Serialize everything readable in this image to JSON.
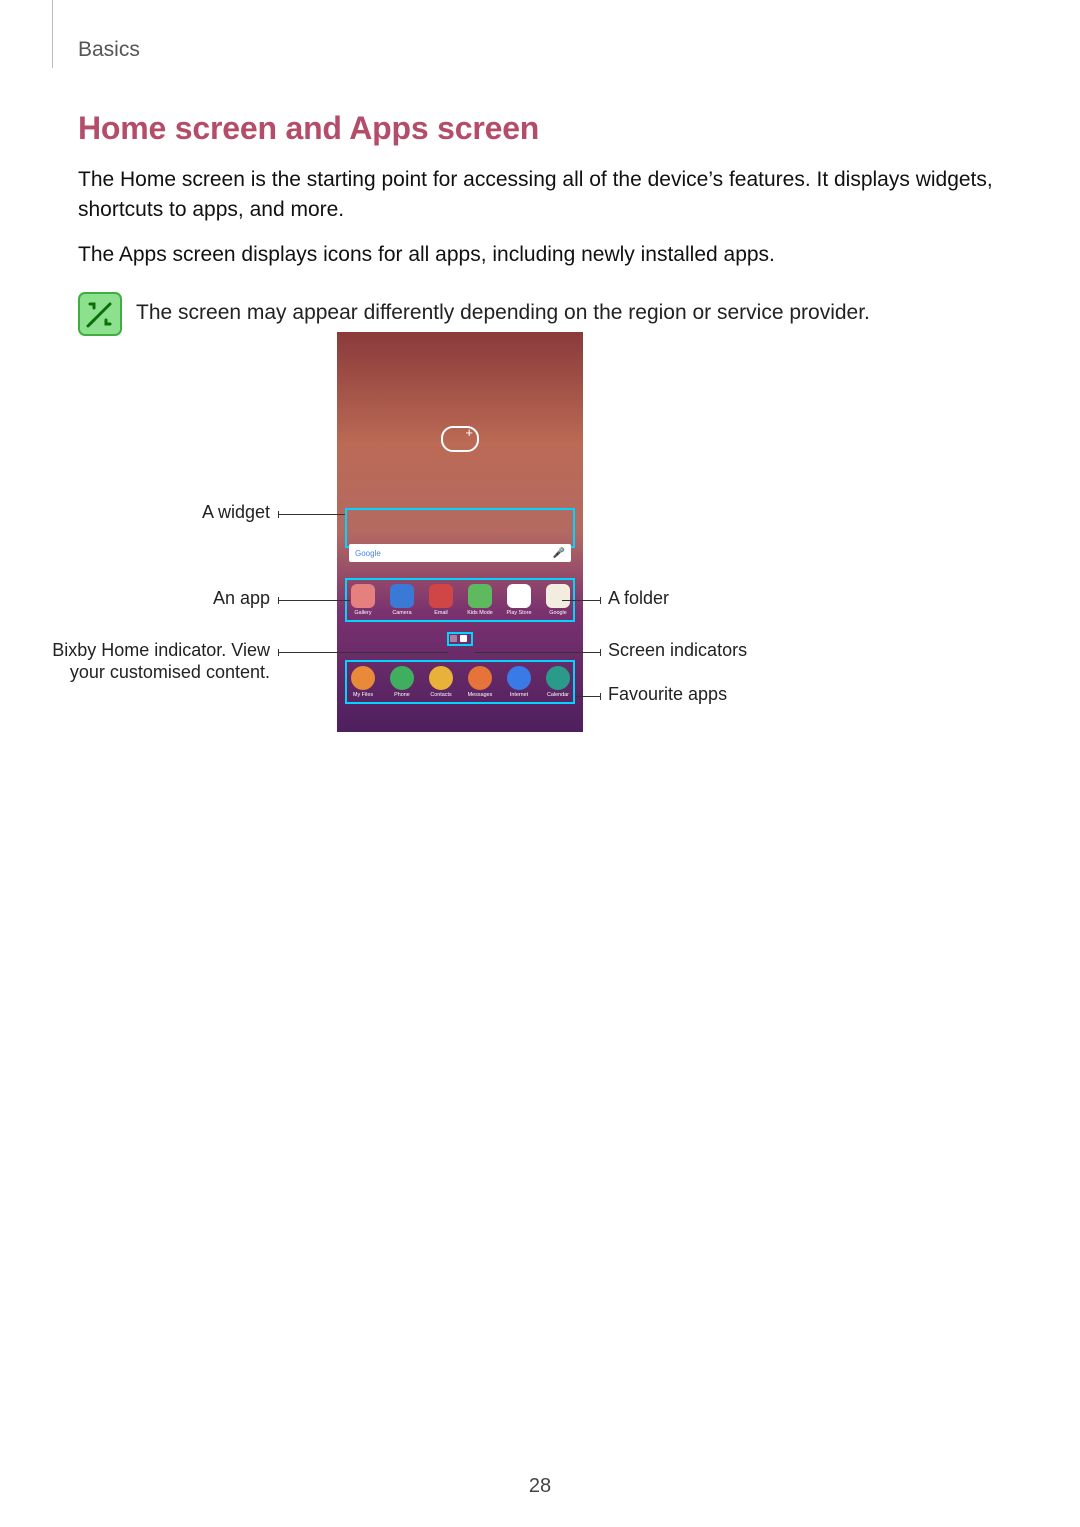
{
  "section": "Basics",
  "title": "Home screen and Apps screen",
  "para1": "The Home screen is the starting point for accessing all of the device’s features. It displays widgets, shortcuts to apps, and more.",
  "para2": "The Apps screen displays icons for all apps, including newly installed apps.",
  "note": "The screen may appear differently depending on the region or service provider.",
  "callouts": {
    "widget": "A widget",
    "app": "An app",
    "bixby1": "Bixby Home indicator. View",
    "bixby2": "your customised content.",
    "folder": "A folder",
    "indicators": "Screen indicators",
    "favs": "Favourite apps"
  },
  "searchbar": {
    "brand": "Google"
  },
  "apps_row": [
    {
      "label": "Gallery"
    },
    {
      "label": "Camera"
    },
    {
      "label": "Email"
    },
    {
      "label": "Kids Mode"
    },
    {
      "label": "Play Store"
    },
    {
      "label": "Google"
    }
  ],
  "fav_row": [
    {
      "label": "My Files"
    },
    {
      "label": "Phone"
    },
    {
      "label": "Contacts"
    },
    {
      "label": "Messages"
    },
    {
      "label": "Internet"
    },
    {
      "label": "Calendar"
    }
  ],
  "page_number": "28"
}
